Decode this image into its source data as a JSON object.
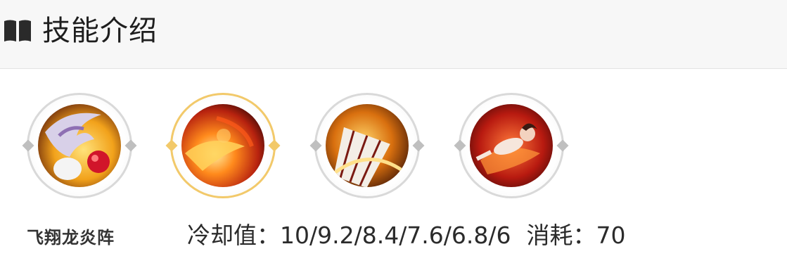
{
  "header": {
    "icon": "book-icon",
    "title": "技能介绍"
  },
  "skills": [
    {
      "icon": "skill-1-icon",
      "active": false
    },
    {
      "icon": "skill-2-icon",
      "active": true
    },
    {
      "icon": "skill-3-icon",
      "active": false
    },
    {
      "icon": "skill-4-icon",
      "active": false
    }
  ],
  "detail": {
    "skill_name": "飞翔龙炎阵",
    "cooldown_label": "冷却值：",
    "cooldown_value": "10/9.2/8.4/7.6/6.8/6",
    "cost_label": "消耗：",
    "cost_value": "70"
  },
  "colors": {
    "active_ring": "#f2c96a",
    "inactive_ring": "#d9d9d9",
    "header_bg": "#f7f7f7"
  }
}
